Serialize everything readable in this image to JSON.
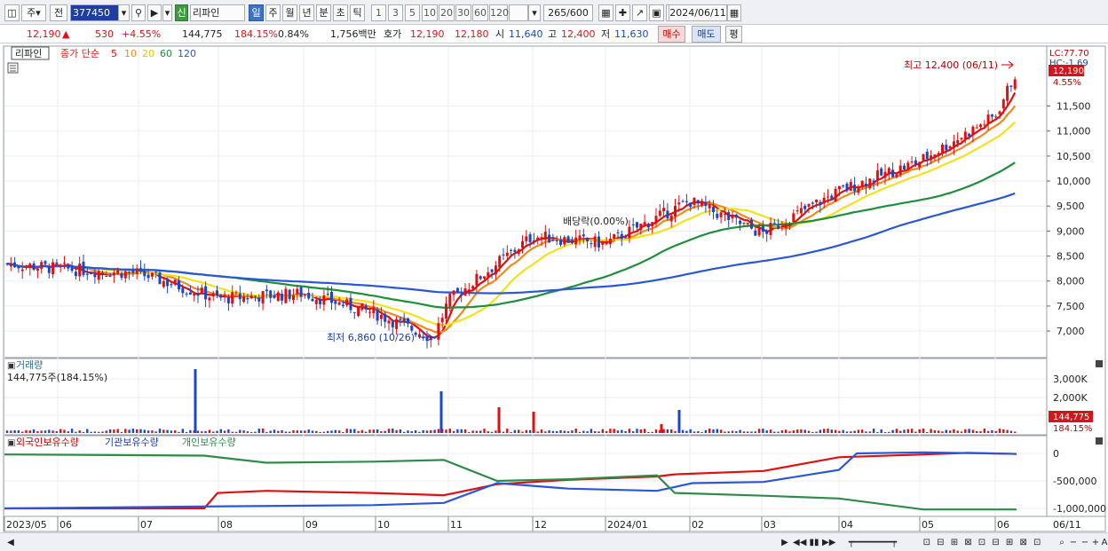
{
  "toolbar": {
    "market": "주",
    "prev": "전",
    "code": "377450",
    "sin_badge": "신",
    "stock_name": "리파인",
    "periods": [
      "일",
      "주",
      "월",
      "년",
      "분",
      "초",
      "틱"
    ],
    "active_period": "일",
    "nums": [
      "1",
      "3",
      "5",
      "10",
      "20",
      "30",
      "60",
      "120"
    ],
    "count": "265/600",
    "date": "2024/06/11"
  },
  "quote": {
    "price": "12,190",
    "arrow": "▲",
    "change": "530",
    "change_pct": "+4.55%",
    "volume": "144,775",
    "volume_ratio": "184.15%",
    "turnover": "0.84%",
    "amount": "1,756백만",
    "hoga_label": "호가",
    "ask": "12,190",
    "bid": "12,180",
    "open_label": "시",
    "open": "11,640",
    "high_label": "고",
    "high": "12,400",
    "low_label": "저",
    "low": "11,630",
    "buy": "매수",
    "sell": "매도",
    "eval": "평"
  },
  "price_pane": {
    "stock_tag": "리파인",
    "ma_label": "종가 단순",
    "ma_periods": [
      "5",
      "10",
      "20",
      "60",
      "120"
    ],
    "ma_colors": [
      "#e01010",
      "#ef8a1c",
      "#f2e21a",
      "#1f8f3a",
      "#2a57d6"
    ],
    "high_note": "최고 12,400 (06/11)",
    "low_note": "최저 6,860 (10/26)",
    "dividend_note": "배당락(0.00%)",
    "lc": "LC:77.70",
    "hc": "HC:-1.69",
    "price_tag": "12,190",
    "pct_tag": "4.55%",
    "y_ticks": [
      "11,500",
      "11,000",
      "10,500",
      "10,000",
      "9,500",
      "9,000",
      "8,500",
      "8,000",
      "7,500",
      "7,000"
    ]
  },
  "volume_pane": {
    "title": "거래량",
    "value_text": "144,775주(184.15%)",
    "y_ticks": [
      "3,000K",
      "2,000K",
      "1,000K"
    ],
    "tag_value": "144,775",
    "tag_pct": "184.15%"
  },
  "holding_pane": {
    "labels": [
      "외국인보유수량",
      "기관보유수량",
      "개인보유수량"
    ],
    "colors": [
      "#e01010",
      "#2a57d6",
      "#2e8b4a"
    ],
    "y_ticks": [
      "0",
      "-500,000",
      "-1,000,000"
    ]
  },
  "x_axis": {
    "labels": [
      "2023/05",
      "06",
      "07",
      "08",
      "09",
      "10",
      "11",
      "12",
      "2024/01",
      "02",
      "03",
      "04",
      "05",
      "06"
    ],
    "right_label": "06/11"
  },
  "chart_data": {
    "type": "candlestick",
    "title": "리파인",
    "y_range": [
      6700,
      12450
    ],
    "series_note": "approximate closing prices, daily",
    "key_points": [
      {
        "x": "2023/05",
        "y": 8350
      },
      {
        "x": "06",
        "y": 8250
      },
      {
        "x": "07",
        "y": 8150
      },
      {
        "x": "08",
        "y": 7650
      },
      {
        "x": "09",
        "y": 7750
      },
      {
        "x": "10",
        "y": 7350
      },
      {
        "x": "10/26",
        "y": 6860
      },
      {
        "x": "11",
        "y": 7600
      },
      {
        "x": "12",
        "y": 8900
      },
      {
        "x": "2024/01",
        "y": 8750
      },
      {
        "x": "02",
        "y": 9600
      },
      {
        "x": "03",
        "y": 8950
      },
      {
        "x": "04",
        "y": 9800
      },
      {
        "x": "05",
        "y": 10400
      },
      {
        "x": "06",
        "y": 11300
      },
      {
        "x": "06/11",
        "y": 12190
      }
    ]
  }
}
